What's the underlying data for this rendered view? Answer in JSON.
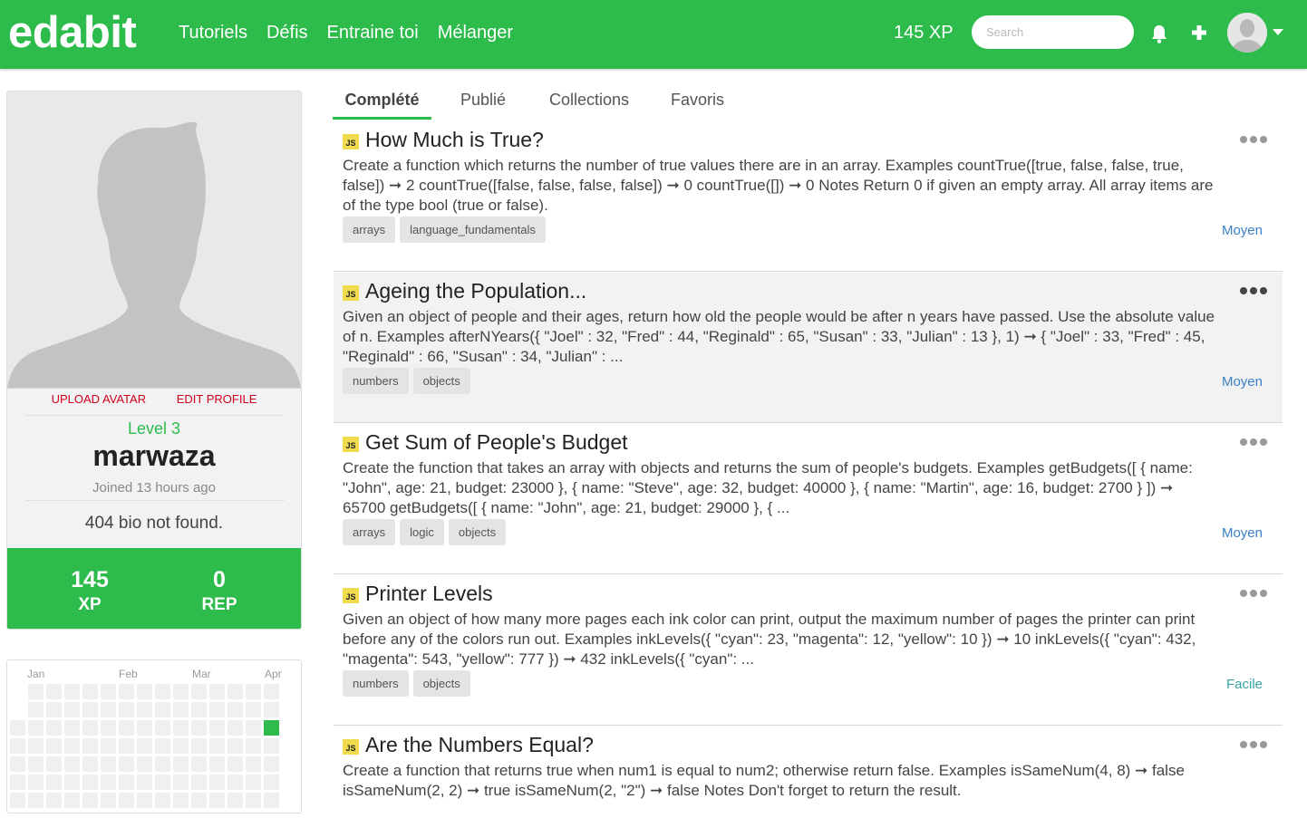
{
  "header": {
    "logo": "edabit",
    "nav": [
      "Tutoriels",
      "Défis",
      "Entraine toi",
      "Mélanger"
    ],
    "xp": "145 XP",
    "search_placeholder": "Search"
  },
  "profile": {
    "upload_avatar": "UPLOAD AVATAR",
    "edit_profile": "EDIT PROFILE",
    "level": "Level 3",
    "username": "marwaza",
    "joined": "Joined 13 hours ago",
    "bio": "404 bio not found.",
    "xp_value": "145",
    "xp_label": "XP",
    "rep_value": "0",
    "rep_label": "REP"
  },
  "heatmap": {
    "months": [
      "Jan",
      "Feb",
      "Mar",
      "Apr"
    ],
    "active_color": "#2dbb4c",
    "empty_color": "#f0f0f0"
  },
  "tabs": [
    "Complété",
    "Publié",
    "Collections",
    "Favoris"
  ],
  "challenges": [
    {
      "lang": "JS",
      "title": "How Much is True?",
      "description": "Create a function which returns the number of true values there are in an array. Examples countTrue([true, false, false, true, false]) ➞ 2 countTrue([false, false, false, false]) ➞ 0 countTrue([]) ➞ 0 Notes Return 0 if given an empty array. All array items are of the type bool (true or false).",
      "tags": [
        "arrays",
        "language_fundamentals"
      ],
      "difficulty": "Moyen"
    },
    {
      "lang": "JS",
      "title": "Ageing the Population...",
      "description": "Given an object of people and their ages, return how old the people would be after n years have passed. Use the absolute value of n. Examples afterNYears({ \"Joel\" : 32, \"Fred\" : 44, \"Reginald\" : 65, \"Susan\" : 33, \"Julian\" : 13 }, 1) ➞ { \"Joel\" : 33, \"Fred\" : 45, \"Reginald\" : 66, \"Susan\" : 34, \"Julian\" : ...",
      "tags": [
        "numbers",
        "objects"
      ],
      "difficulty": "Moyen"
    },
    {
      "lang": "JS",
      "title": "Get Sum of People's Budget",
      "description": "Create the function that takes an array with objects and returns the sum of people's budgets. Examples getBudgets([ { name: \"John\", age: 21, budget: 23000 }, { name: \"Steve\", age: 32, budget: 40000 }, { name: \"Martin\", age: 16, budget: 2700 } ]) ➞ 65700 getBudgets([ { name: \"John\", age: 21, budget: 29000 }, { ...",
      "tags": [
        "arrays",
        "logic",
        "objects"
      ],
      "difficulty": "Moyen"
    },
    {
      "lang": "JS",
      "title": "Printer Levels",
      "description": "Given an object of how many more pages each ink color can print, output the maximum number of pages the printer can print before any of the colors run out. Examples inkLevels({ \"cyan\": 23, \"magenta\": 12, \"yellow\": 10 }) ➞ 10 inkLevels({ \"cyan\": 432, \"magenta\": 543, \"yellow\": 777 }) ➞ 432 inkLevels({ \"cyan\": ...",
      "tags": [
        "numbers",
        "objects"
      ],
      "difficulty": "Facile"
    },
    {
      "lang": "JS",
      "title": "Are the Numbers Equal?",
      "description": "Create a function that returns true when num1 is equal to num2; otherwise return false. Examples isSameNum(4, 8) ➞ false isSameNum(2, 2) ➞ true isSameNum(2, \"2\") ➞ false Notes Don't forget to return the result.",
      "tags": [],
      "difficulty": ""
    }
  ]
}
